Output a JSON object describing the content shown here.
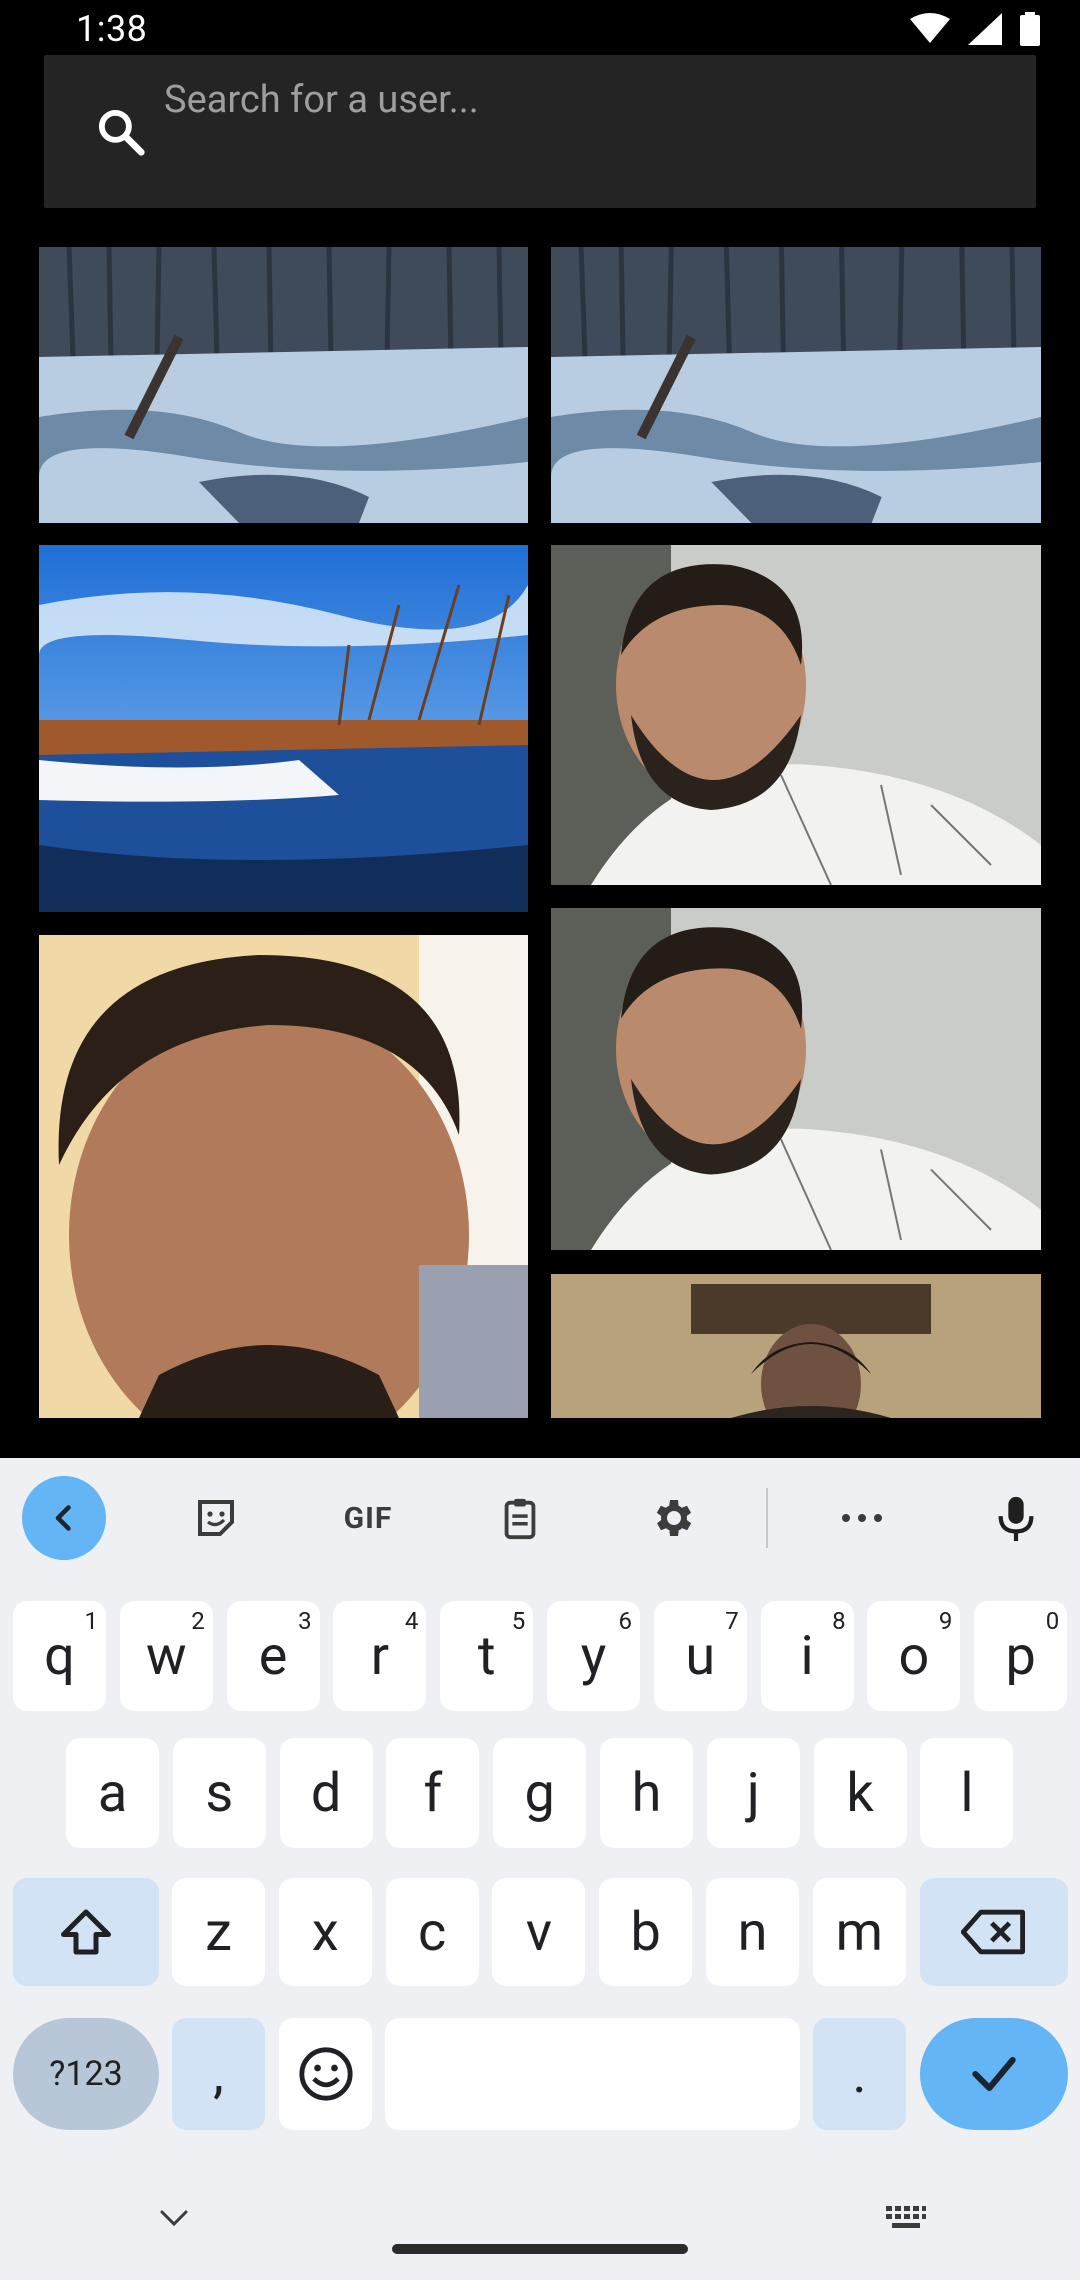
{
  "status_bar": {
    "time": "1:38"
  },
  "search": {
    "placeholder": "Search for a user..."
  },
  "keyboard": {
    "toolbar": {
      "gif": "GIF"
    },
    "row1": [
      {
        "key": "q",
        "hint": "1"
      },
      {
        "key": "w",
        "hint": "2"
      },
      {
        "key": "e",
        "hint": "3"
      },
      {
        "key": "r",
        "hint": "4"
      },
      {
        "key": "t",
        "hint": "5"
      },
      {
        "key": "y",
        "hint": "6"
      },
      {
        "key": "u",
        "hint": "7"
      },
      {
        "key": "i",
        "hint": "8"
      },
      {
        "key": "o",
        "hint": "9"
      },
      {
        "key": "p",
        "hint": "0"
      }
    ],
    "row2": [
      "a",
      "s",
      "d",
      "f",
      "g",
      "h",
      "j",
      "k",
      "l"
    ],
    "row3": [
      "z",
      "x",
      "c",
      "v",
      "b",
      "n",
      "m"
    ],
    "row4": {
      "symbols": "?123",
      "comma": ",",
      "period": "."
    }
  },
  "colors": {
    "accent": "#64b5f6",
    "keyboard_bg": "#eff0f4",
    "search_bg": "#242424"
  }
}
